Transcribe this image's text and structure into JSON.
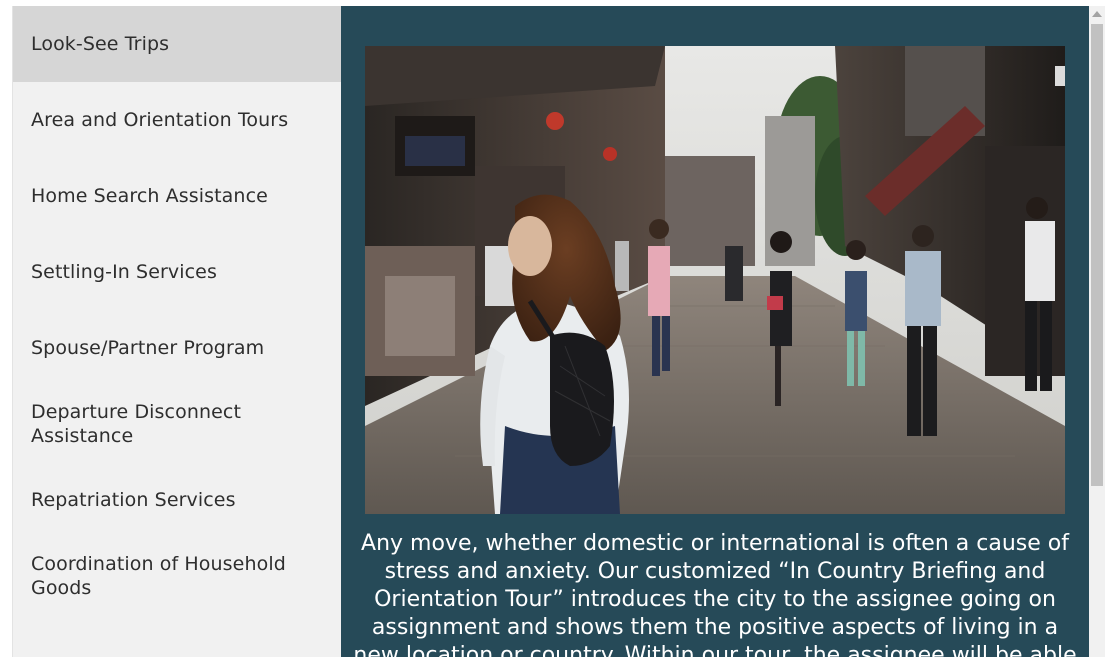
{
  "sidebar": {
    "items": [
      {
        "label": "Look-See Trips",
        "active": true
      },
      {
        "label": "Area and Orientation Tours",
        "active": false
      },
      {
        "label": "Home Search Assistance",
        "active": false
      },
      {
        "label": "Settling-In Services",
        "active": false
      },
      {
        "label": "Spouse/Partner Program",
        "active": false
      },
      {
        "label": "Departure Disconnect Assistance",
        "active": false
      },
      {
        "label": "Repatriation Services",
        "active": false
      },
      {
        "label": "Coordination of Household Goods",
        "active": false
      }
    ]
  },
  "content": {
    "photo_icon": "street-scene-photo",
    "description": "Any move, whether domestic or international is often a cause of stress and anxiety. Our customized “In Country Briefing and Orientation Tour” introduces the city to the assignee going on assignment and shows them the positive aspects of living in a new location or country. Within our tour, the assignee will be able"
  },
  "colors": {
    "panel_background": "#264a58",
    "sidebar_background": "#f1f1f1",
    "sidebar_active": "#d6d6d6",
    "text_dark": "#2e2e2e",
    "text_light": "#ffffff"
  },
  "scrollbar": {
    "up_arrow_icon": "triangle-up-icon"
  }
}
